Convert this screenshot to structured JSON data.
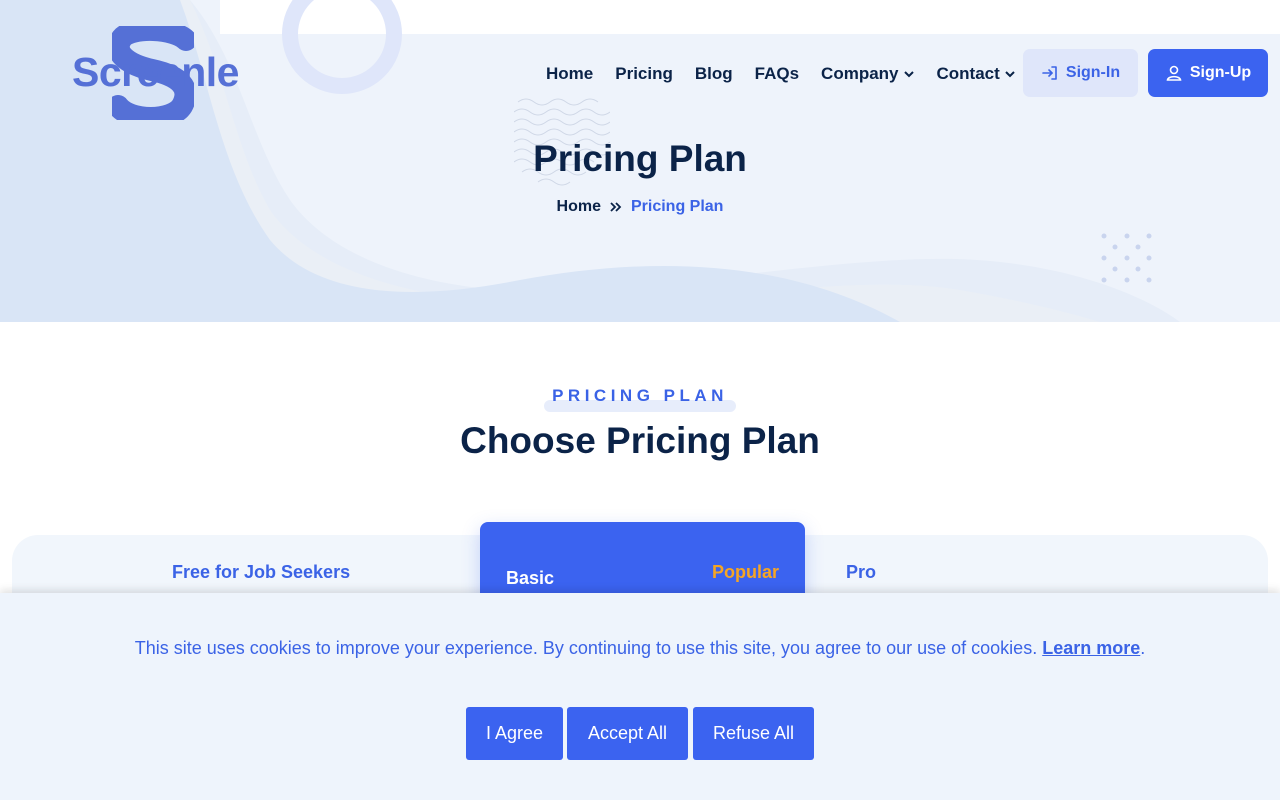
{
  "brand": {
    "name": "Screenle",
    "logo_icon": "s-logo-icon"
  },
  "nav": {
    "items": [
      {
        "label": "Home",
        "dropdown": false
      },
      {
        "label": "Pricing",
        "dropdown": false
      },
      {
        "label": "Blog",
        "dropdown": false
      },
      {
        "label": "FAQs",
        "dropdown": false
      },
      {
        "label": "Company",
        "dropdown": true
      },
      {
        "label": "Contact",
        "dropdown": true
      }
    ],
    "signin_label": "Sign-In",
    "signup_label": "Sign-Up"
  },
  "hero": {
    "title": "Pricing Plan",
    "breadcrumb": {
      "home": "Home",
      "current": "Pricing Plan"
    }
  },
  "section": {
    "kicker": "PRICING PLAN",
    "title": "Choose Pricing Plan"
  },
  "plans": {
    "free": "Free for Job Seekers",
    "basic": "Basic",
    "popular_badge": "Popular",
    "pro": "Pro"
  },
  "cookie": {
    "text": "This site uses cookies to improve your experience. By continuing to use this site, you agree to our use of cookies.",
    "link": "Learn more",
    "trailing": ".",
    "agree_label": "I Agree",
    "accept_label": "Accept All",
    "refuse_label": "Refuse All"
  },
  "colors": {
    "primary": "#3b63f0",
    "navy": "#0b2348",
    "accent": "#f5a524",
    "hero_bg": "#eef3fb"
  }
}
